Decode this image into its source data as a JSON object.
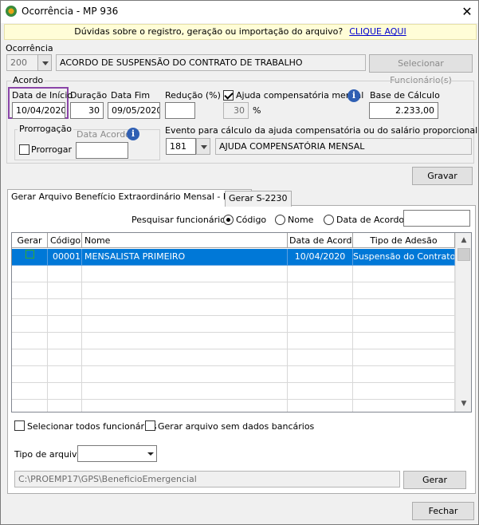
{
  "window": {
    "title": "Ocorrência - MP 936",
    "close_glyph": "✕"
  },
  "banner": {
    "text": "Dúvidas sobre o registro, geração ou importação do arquivo?",
    "link": "CLIQUE AQUI"
  },
  "ocorrencia": {
    "label": "Ocorrência",
    "code": "200",
    "description": "ACORDO DE SUSPENSÃO DO CONTRATO DE TRABALHO",
    "select_button": "Selecionar Funcionário(s)"
  },
  "acordo": {
    "group_title": "Acordo",
    "data_inicio_label": "Data de Início",
    "data_inicio": "10/04/2020",
    "duracao_label": "Duração",
    "duracao": "30",
    "data_fim_label": "Data Fim",
    "data_fim": "09/05/2020",
    "reducao_label": "Redução (%)",
    "reducao": "",
    "ajuda_label": "Ajuda compensatória mensal",
    "ajuda_checked": true,
    "ajuda_value": "30",
    "percent_sign": "%",
    "base_calculo_label": "Base de Cálculo",
    "base_calculo": "2.233,00",
    "prorrogacao_title": "Prorrogação",
    "prorrogar_label": "Prorrogar",
    "data_acordo_label": "Data Acordo",
    "data_acordo": "",
    "evento_label": "Evento para cálculo da ajuda compensatória ou do salário proporcional",
    "evento_code": "181",
    "evento_description": "AJUDA COMPENSATÓRIA MENSAL"
  },
  "gravar_button": "Gravar",
  "tabs": [
    {
      "label": "Gerar Arquivo Benefício Extraordinário Mensal - B.E.M",
      "active": true
    },
    {
      "label": "Gerar S-2230",
      "active": false
    }
  ],
  "search": {
    "label": "Pesquisar funcionário",
    "options": [
      "Código",
      "Nome",
      "Data de Acordo"
    ],
    "selected": "Código",
    "value": ""
  },
  "grid": {
    "columns": [
      "Gerar",
      "Código",
      "Nome",
      "Data de Acordo",
      "Tipo de Adesão"
    ],
    "rows": [
      {
        "gerar": "",
        "codigo": "00001",
        "nome": "MENSALISTA PRIMEIRO",
        "data_acordo": "10/04/2020",
        "tipo_adesao": "Suspensão do Contrato"
      }
    ],
    "scroll_up": "▲",
    "scroll_down": "▼"
  },
  "options": {
    "select_all": "Selecionar todos funcionários",
    "no_bank_data": "Gerar arquivo sem dados bancários"
  },
  "tipo_arquivo": {
    "label": "Tipo de arquivo",
    "value": ""
  },
  "path": {
    "value": "C:\\PROEMP17\\GPS\\BeneficioEmergencial"
  },
  "gerar_button": "Gerar",
  "fechar_button": "Fechar"
}
